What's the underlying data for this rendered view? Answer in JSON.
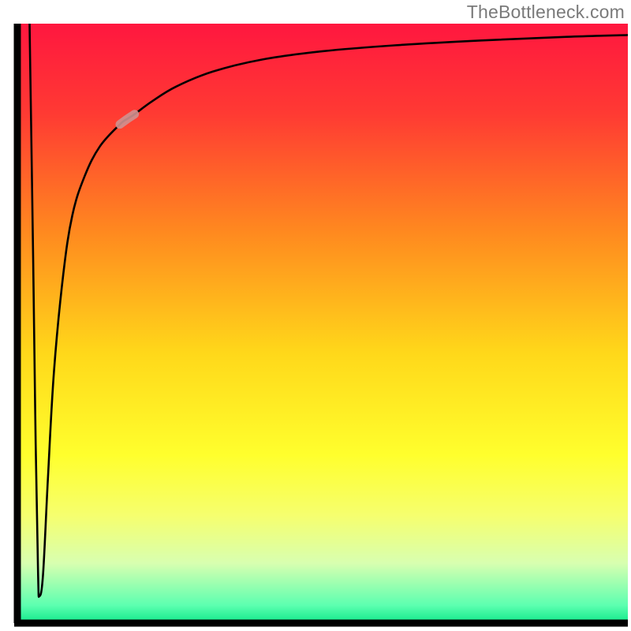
{
  "watermark": "TheBottleneck.com",
  "chart_data": {
    "type": "line",
    "title": "",
    "xlabel": "",
    "ylabel": "",
    "xlim": [
      0,
      100
    ],
    "ylim": [
      0,
      100
    ],
    "grid": false,
    "legend": "none",
    "background_gradient_stops": [
      {
        "offset": 0.0,
        "color": "#ff173f"
      },
      {
        "offset": 0.15,
        "color": "#ff3a33"
      },
      {
        "offset": 0.35,
        "color": "#ff8a1f"
      },
      {
        "offset": 0.55,
        "color": "#ffd81a"
      },
      {
        "offset": 0.72,
        "color": "#ffff2d"
      },
      {
        "offset": 0.82,
        "color": "#f6ff6e"
      },
      {
        "offset": 0.9,
        "color": "#d8ffb0"
      },
      {
        "offset": 0.97,
        "color": "#5dffb0"
      },
      {
        "offset": 1.0,
        "color": "#10e98a"
      }
    ],
    "series": [
      {
        "name": "main-curve",
        "x": [
          2.0,
          2.6,
          3.0,
          3.4,
          3.6,
          4.2,
          5.0,
          6.0,
          7.5,
          9.0,
          11.0,
          13.5,
          16.8,
          18.0,
          19.2,
          22.0,
          26.0,
          32.0,
          40.0,
          50.0,
          62.0,
          76.0,
          90.0,
          100.0
        ],
        "y": [
          100,
          60,
          30,
          8,
          4.5,
          8,
          24,
          42,
          58,
          68,
          74.5,
          79.5,
          83.2,
          84.1,
          84.9,
          87.0,
          89.5,
          92.0,
          94.0,
          95.4,
          96.4,
          97.2,
          97.8,
          98.1
        ]
      }
    ],
    "highlight_segment": {
      "series": "main-curve",
      "x_start": 16.8,
      "x_end": 19.2,
      "note": "slightly desaturated overlay stroke on this portion of the curve"
    }
  }
}
